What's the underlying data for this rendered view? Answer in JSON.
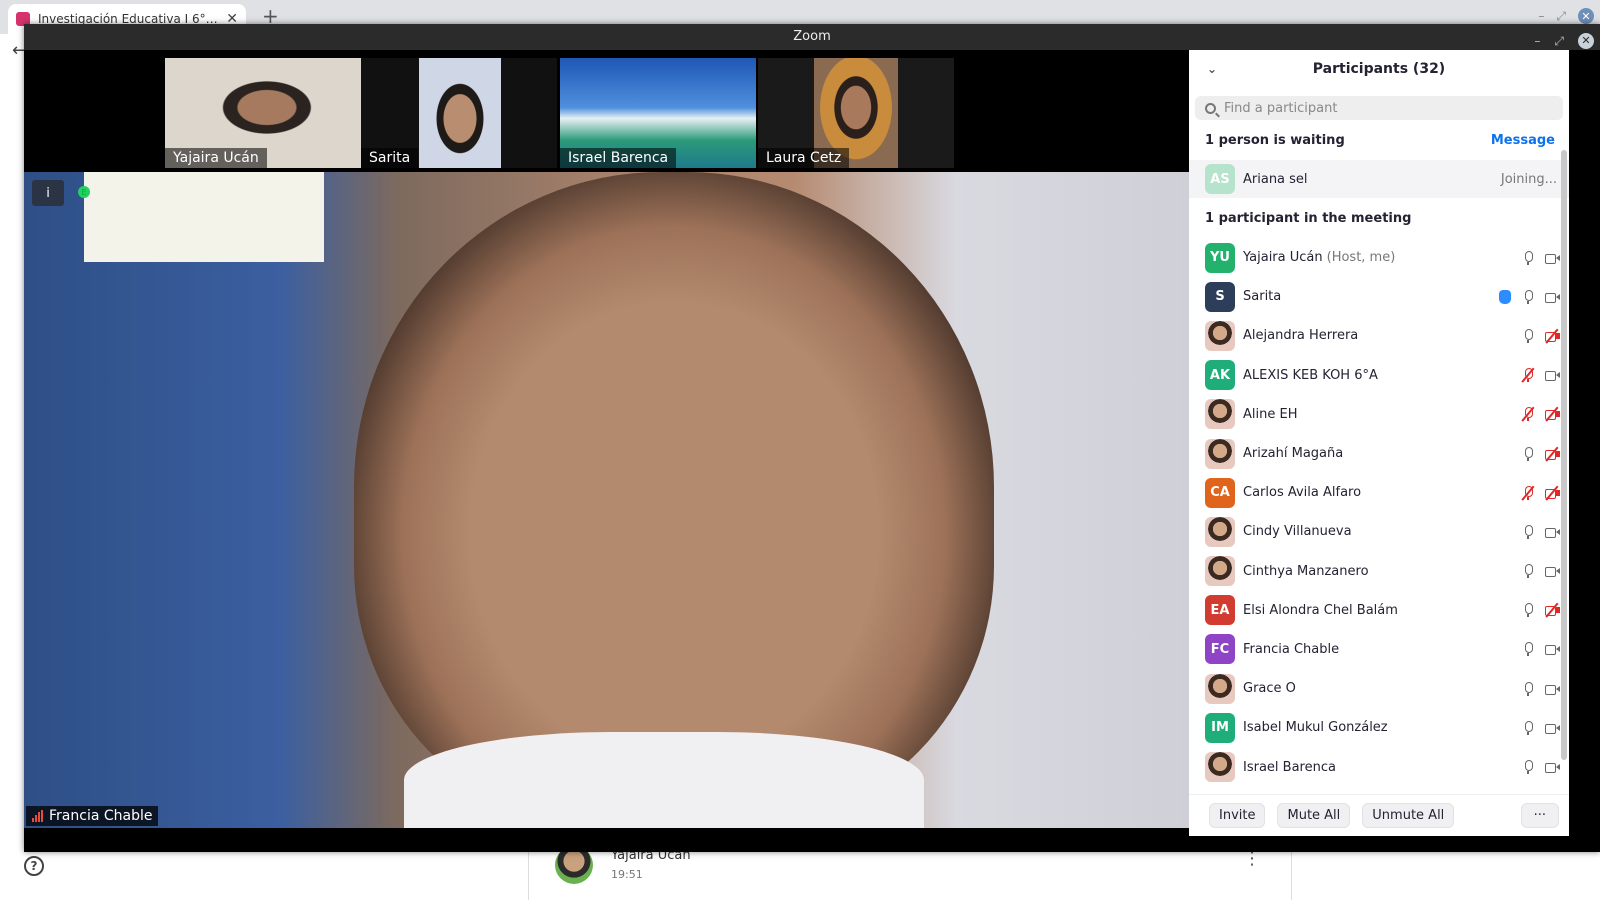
{
  "browser": {
    "tab_title": "Investigación Educativa I 6°A y",
    "tab_close": "✕",
    "new_tab": "+",
    "close": "✕"
  },
  "chat": {
    "sender": "Yajaira Ucan",
    "time": "19:51"
  },
  "zoom": {
    "window_title": "Zoom",
    "gallery": [
      {
        "name": "Yajaira Ucán"
      },
      {
        "name": "Sarita"
      },
      {
        "name": "Israel Barenca"
      },
      {
        "name": "Laura Cetz"
      }
    ],
    "active_speaker": "Francia Chable",
    "info_icon": "i"
  },
  "participants": {
    "title": "Participants (32)",
    "search_placeholder": "Find a participant",
    "waiting_header": "1 person is waiting",
    "message_label": "Message",
    "waiting_person": {
      "initials": "AS",
      "name": "Ariana sel",
      "status": "Joining...",
      "color": "#b6e3cc"
    },
    "meeting_header": "1 participant in the meeting",
    "list": [
      {
        "initials": "YU",
        "name": "Yajaira Ucán",
        "role": "(Host, me)",
        "color": "#23b26d",
        "mic": "on",
        "video": "on",
        "hand": false
      },
      {
        "initials": "S",
        "name": "Sarita",
        "role": "",
        "color": "#2c3e5a",
        "mic": "on",
        "video": "on",
        "hand": true
      },
      {
        "initials": "",
        "name": "Alejandra Herrera",
        "role": "",
        "color": "photo",
        "mic": "on",
        "video": "off",
        "hand": false
      },
      {
        "initials": "AK",
        "name": "ALEXIS KEB KOH 6°A",
        "role": "",
        "color": "#1fae79",
        "mic": "off",
        "video": "on",
        "hand": false
      },
      {
        "initials": "",
        "name": "Aline EH",
        "role": "",
        "color": "photo",
        "mic": "off",
        "video": "off",
        "hand": false
      },
      {
        "initials": "",
        "name": "Arizahí Magaña",
        "role": "",
        "color": "photo",
        "mic": "on",
        "video": "off",
        "hand": false
      },
      {
        "initials": "CA",
        "name": "Carlos Avila Alfaro",
        "role": "",
        "color": "#e0641b",
        "mic": "off",
        "video": "off",
        "hand": false
      },
      {
        "initials": "",
        "name": "Cindy Villanueva",
        "role": "",
        "color": "photo",
        "mic": "on",
        "video": "on",
        "hand": false
      },
      {
        "initials": "",
        "name": "Cinthya Manzanero",
        "role": "",
        "color": "photo",
        "mic": "on",
        "video": "on",
        "hand": false
      },
      {
        "initials": "EA",
        "name": "Elsi Alondra Chel Balám",
        "role": "",
        "color": "#d23b2f",
        "mic": "on",
        "video": "off",
        "hand": false
      },
      {
        "initials": "FC",
        "name": "Francia Chable",
        "role": "",
        "color": "#8e44c4",
        "mic": "on",
        "video": "on",
        "hand": false
      },
      {
        "initials": "",
        "name": "Grace O",
        "role": "",
        "color": "photo",
        "mic": "on",
        "video": "on",
        "hand": false
      },
      {
        "initials": "IM",
        "name": "Isabel Mukul González",
        "role": "",
        "color": "#1fae79",
        "mic": "on",
        "video": "on",
        "hand": false
      },
      {
        "initials": "",
        "name": "Israel Barenca",
        "role": "",
        "color": "photo",
        "mic": "on",
        "video": "on",
        "hand": false
      }
    ],
    "footer": {
      "invite": "Invite",
      "mute_all": "Mute All",
      "unmute_all": "Unmute All",
      "more": "···"
    }
  }
}
